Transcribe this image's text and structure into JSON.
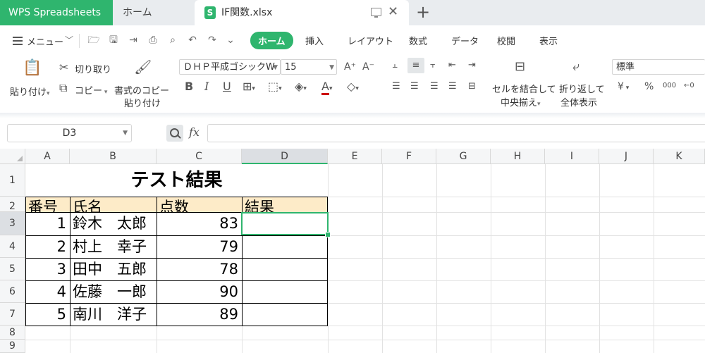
{
  "titlebar": {
    "app_tab": "WPS Spreadsheets",
    "home_tab": "ホーム",
    "file_tab": "IF関数.xlsx",
    "file_icon_letter": "S",
    "close_glyph": "✕",
    "add_glyph": "+"
  },
  "menubar": {
    "menu_label": "メニュー",
    "tabs": [
      "ホーム",
      "挿入",
      "レイアウト",
      "数式",
      "データ",
      "校閲",
      "表示"
    ],
    "active_tab": "ホーム",
    "accent_color": "#2fb56e"
  },
  "ribbon": {
    "paste": "貼り付け",
    "cut": "切り取り",
    "copy": "コピー",
    "format_copy_line1": "書式のコピー",
    "format_copy_line2": "貼り付け",
    "font_name": "ＤＨＰ平成ゴシックW",
    "font_size": "15",
    "bold": "B",
    "italic": "I",
    "underline": "U",
    "merge_line1": "セルを結合して",
    "merge_line2": "中央揃え",
    "wrap_line1": "折り返して",
    "wrap_line2": "全体表示",
    "number_format": "標準",
    "currency": "¥",
    "percent": "%",
    "thousands": "000"
  },
  "formula_bar": {
    "name_box": "D3",
    "fx_label": "fx",
    "formula": ""
  },
  "sheet": {
    "columns": [
      "A",
      "B",
      "C",
      "D",
      "E",
      "F",
      "G",
      "H",
      "I",
      "J",
      "K"
    ],
    "rows": [
      "1",
      "2",
      "3",
      "4",
      "5",
      "6",
      "7",
      "8",
      "9"
    ],
    "selected_cell": "D3",
    "title": "テスト結果",
    "headers": [
      "番号",
      "氏名",
      "点数",
      "結果"
    ],
    "records": [
      {
        "no": "1",
        "name": "鈴木　太郎",
        "score": "83",
        "result": ""
      },
      {
        "no": "2",
        "name": "村上　幸子",
        "score": "79",
        "result": ""
      },
      {
        "no": "3",
        "name": "田中　五郎",
        "score": "78",
        "result": ""
      },
      {
        "no": "4",
        "name": "佐藤　一郎",
        "score": "90",
        "result": ""
      },
      {
        "no": "5",
        "name": "南川　洋子",
        "score": "89",
        "result": ""
      }
    ],
    "header_fill": "#fdebc8"
  }
}
